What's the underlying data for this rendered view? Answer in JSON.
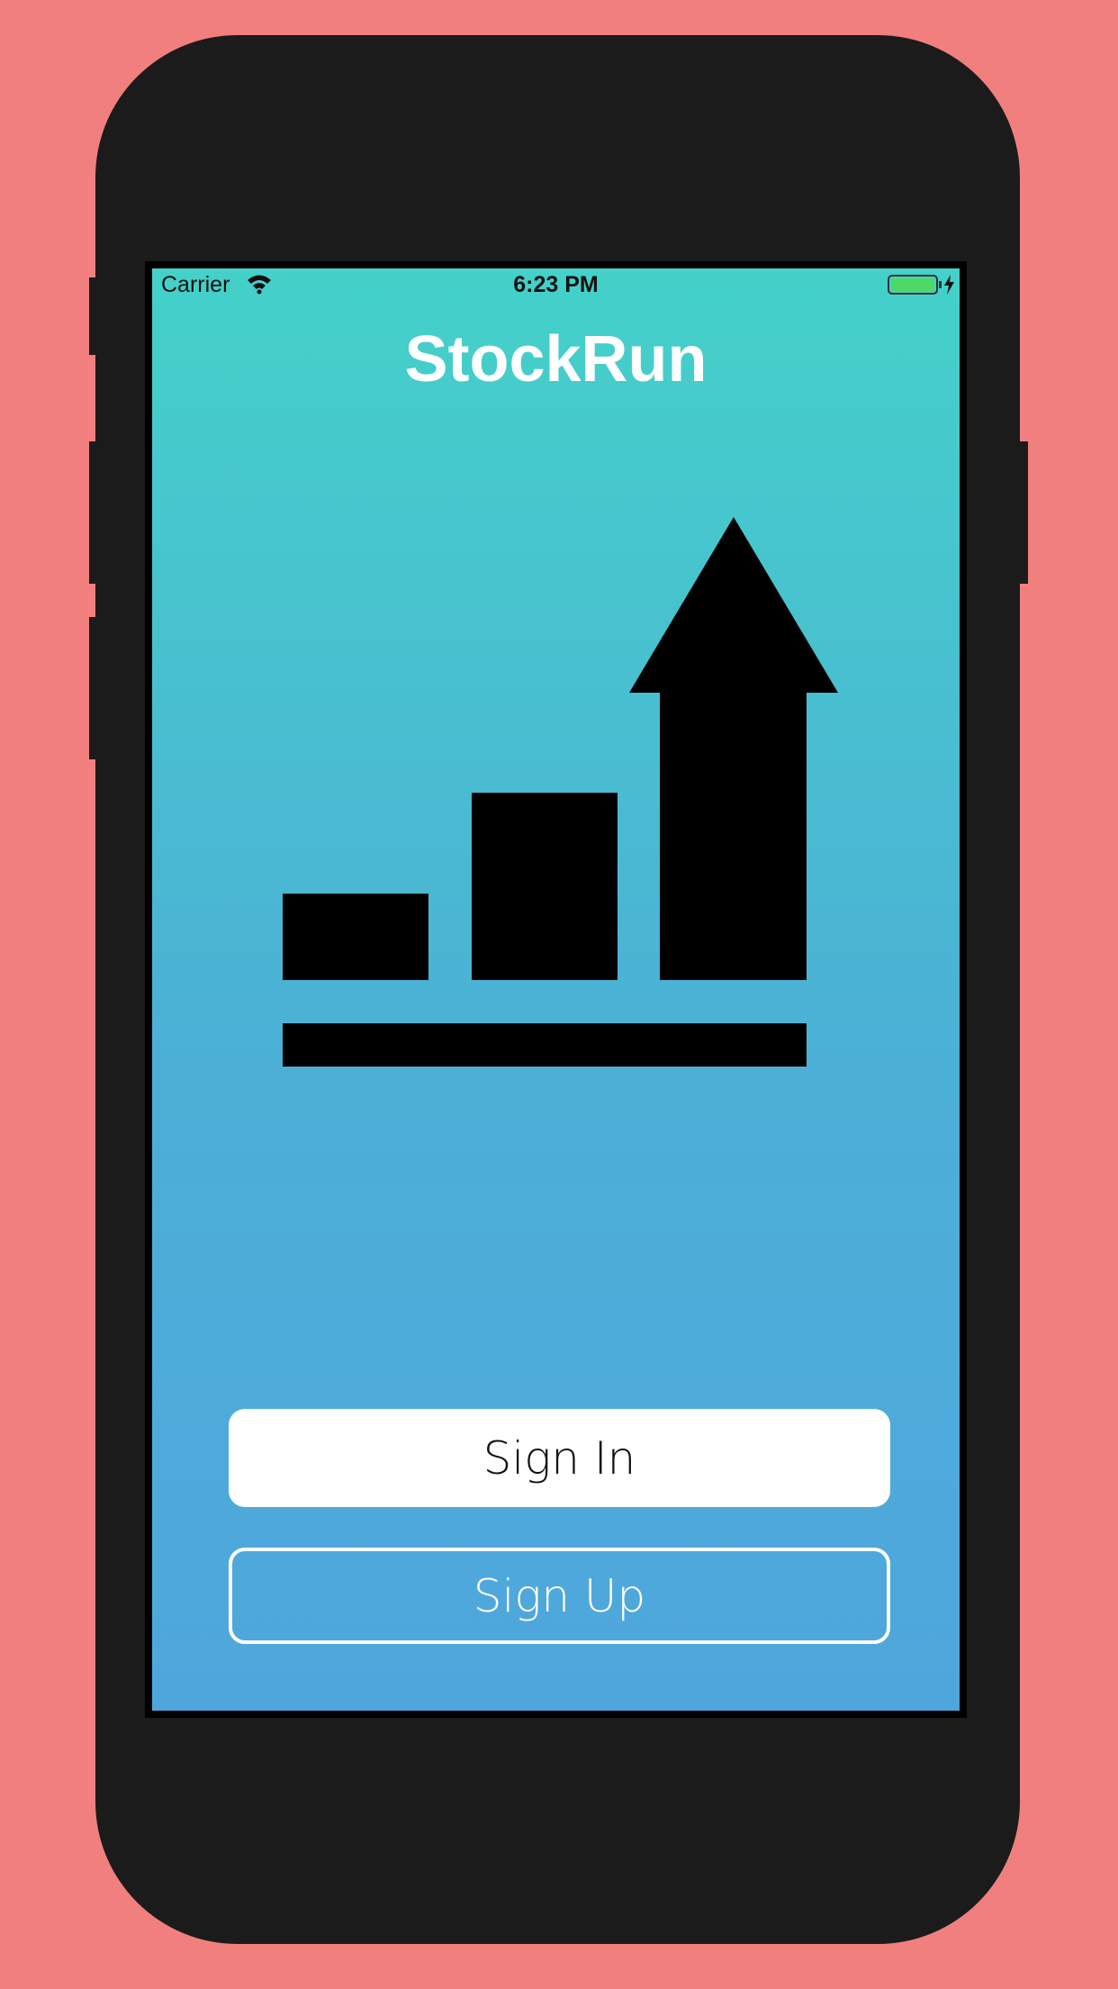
{
  "status_bar": {
    "carrier": "Carrier",
    "time": "6:23 PM",
    "battery_color": "#4CD964"
  },
  "app": {
    "title": "StockRun",
    "logo_icon": "growth-chart-arrow-icon"
  },
  "buttons": {
    "sign_in": "Sign In",
    "sign_up": "Sign Up"
  },
  "colors": {
    "background": "#F07F7E",
    "phone_body": "#1B1B1B",
    "gradient_top": "#44D1C9",
    "gradient_bottom": "#4FA6DD"
  }
}
